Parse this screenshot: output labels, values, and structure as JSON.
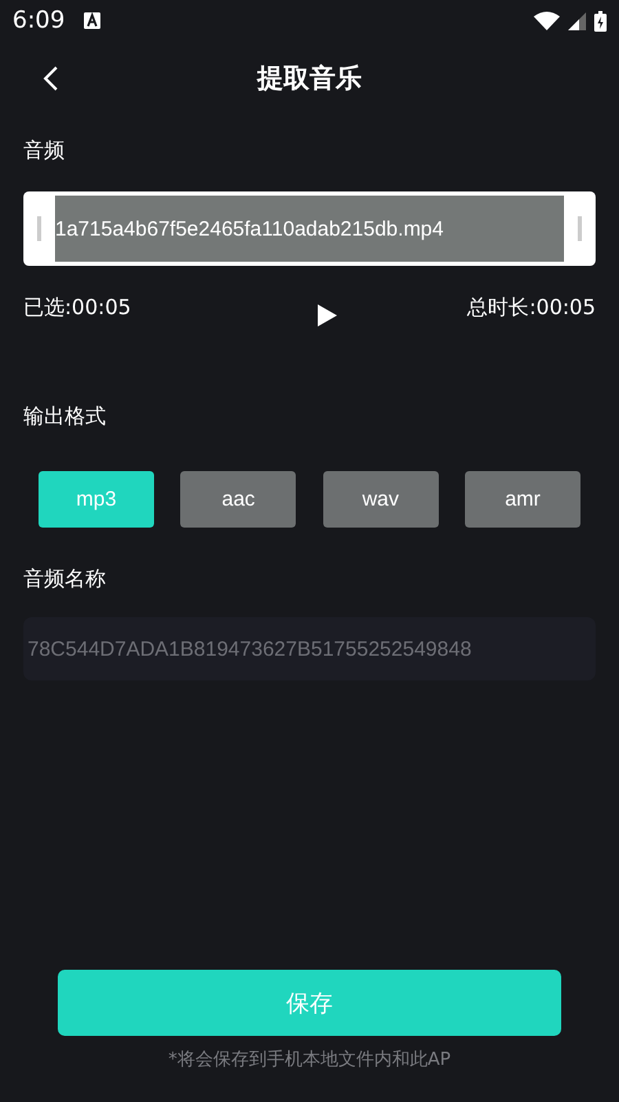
{
  "status_bar": {
    "time": "6:09"
  },
  "header": {
    "title": "提取音乐"
  },
  "audio": {
    "label": "音频",
    "file_name": "1a715a4b67f5e2465fa110adab215db.mp4",
    "selected_time": "已选:00:05",
    "total_time": "总时长:00:05"
  },
  "output_format": {
    "label": "输出格式",
    "options": [
      {
        "label": "mp3",
        "selected": true
      },
      {
        "label": "aac",
        "selected": false
      },
      {
        "label": "wav",
        "selected": false
      },
      {
        "label": "amr",
        "selected": false
      }
    ]
  },
  "audio_name": {
    "label": "音频名称",
    "placeholder": "78C544D7ADA1B819473627B51755252549848"
  },
  "save_button": "保存",
  "note": "*将会保存到手机本地文件内和此AP"
}
